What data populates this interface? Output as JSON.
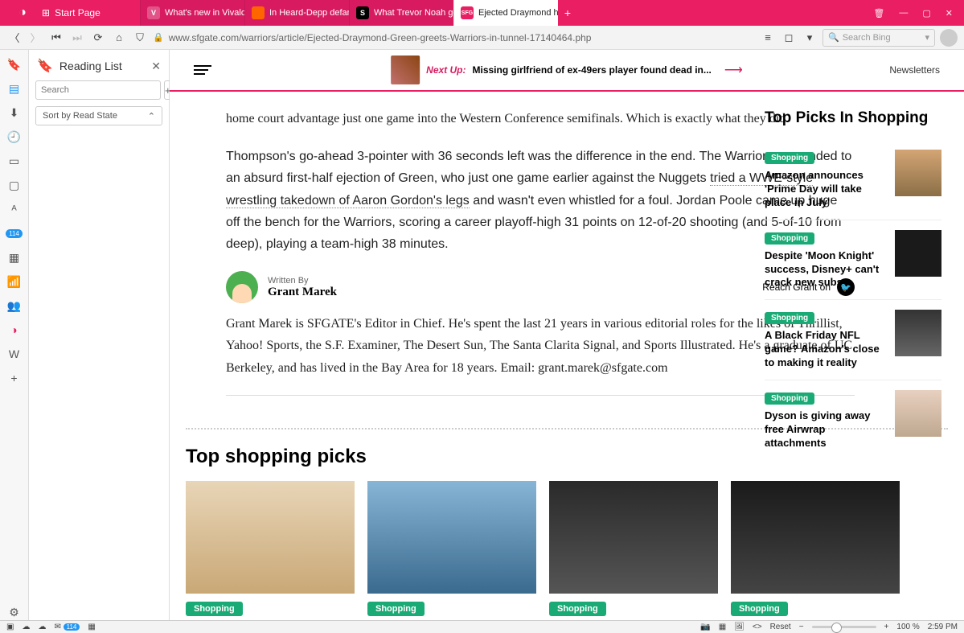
{
  "tabs": {
    "start": "Start Page",
    "t1": "What's new in Vivaldi | Viv",
    "t2": "In Heard-Depp defamation",
    "t3": "What Trevor Noah got wro",
    "t4": "Ejected Draymond has NS",
    "newtab": "+"
  },
  "addr": {
    "url": "www.sfgate.com/warriors/article/Ejected-Draymond-Green-greets-Warriors-in-tunnel-17140464.php",
    "search_placeholder": "Search Bing"
  },
  "panel": {
    "title": "Reading List",
    "search_placeholder": "Search",
    "sort": "Sort by Read State"
  },
  "page_header": {
    "nextup_label": "Next Up:",
    "nextup_text": "Missing girlfriend of ex-49ers player found dead in...",
    "newsletters": "Newsletters"
  },
  "article": {
    "p1a": "home court advantage just one game into the Western Conference semifinals. Which is exactly what they did.",
    "p2a": "Thompson's go-ahead 3-pointer with 36 seconds left was the difference in the end. The Warriors responded to an absurd first-half ejection of Green, who just one game earlier against the Nuggets ",
    "p2link": "tried a WWE-style wrestling takedown of Aaron Gordon's legs",
    "p2b": " and wasn't even whistled for a foul. Jordan Poole came up huge off the bench for the Warriors, scoring a career playoff-high 31 points on 12-of-20 shooting (and 5-of-10 from deep), playing a team-high 38 minutes."
  },
  "author": {
    "writtenby": "Written By",
    "name": "Grant Marek",
    "reach": "Reach Grant on",
    "bio": "Grant Marek is SFGATE's Editor in Chief. He's spent the last 21 years in various editorial roles for the likes of Thrillist, Yahoo! Sports, the S.F. Examiner, The Desert Sun, The Santa Clarita Signal, and Sports Illustrated. He's a graduate of UC Berkeley, and has lived in the Bay Area for 18 years. Email: grant.marek@sfgate.com"
  },
  "sidebar": {
    "heading": "Top Picks In Shopping",
    "tag": "Shopping",
    "picks": [
      "Amazon announces 'Prime Day will take place in July'",
      "Despite 'Moon Knight' success, Disney+ can't crack new subs",
      "A Black Friday NFL game? Amazon's close to making it reality",
      "Dyson is giving away free Airwrap attachments"
    ]
  },
  "shopping": {
    "heading": "Top shopping picks",
    "tag": "Shopping"
  },
  "status": {
    "badge": "114",
    "reset": "Reset",
    "zoom": "100 %",
    "time": "2:59 PM"
  }
}
